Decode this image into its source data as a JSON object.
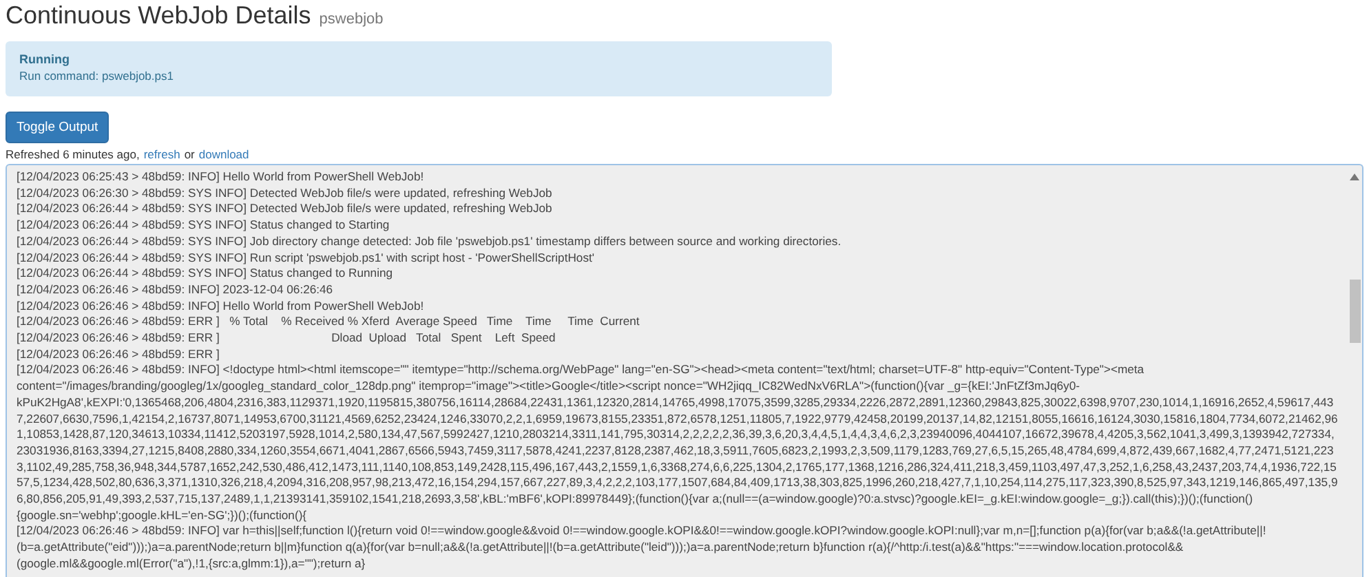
{
  "page_title": "Continuous WebJob Details",
  "job_name": "pswebjob",
  "status": {
    "state": "Running",
    "command": "Run command: pswebjob.ps1"
  },
  "toggle_button": "Toggle Output",
  "refresh_info": {
    "text": "Refreshed 6 minutes ago,",
    "refresh_link": "refresh",
    "separator": "or",
    "download_link": "download"
  },
  "log_lines": [
    "[12/04/2023 06:25:43 > 48bd59: INFO] Hello World from PowerShell WebJob!",
    "[12/04/2023 06:26:30 > 48bd59: SYS INFO] Detected WebJob file/s were updated, refreshing WebJob",
    "[12/04/2023 06:26:44 > 48bd59: SYS INFO] Detected WebJob file/s were updated, refreshing WebJob",
    "[12/04/2023 06:26:44 > 48bd59: SYS INFO] Status changed to Starting",
    "[12/04/2023 06:26:44 > 48bd59: SYS INFO] Job directory change detected: Job file 'pswebjob.ps1' timestamp differs between source and working directories.",
    "[12/04/2023 06:26:44 > 48bd59: SYS INFO] Run script 'pswebjob.ps1' with script host - 'PowerShellScriptHost'",
    "[12/04/2023 06:26:44 > 48bd59: SYS INFO] Status changed to Running",
    "[12/04/2023 06:26:46 > 48bd59: INFO] 2023-12-04 06:26:46",
    "[12/04/2023 06:26:46 > 48bd59: INFO] Hello World from PowerShell WebJob!",
    "[12/04/2023 06:26:46 > 48bd59: ERR ]   % Total    % Received % Xferd  Average Speed   Time    Time     Time  Current",
    "[12/04/2023 06:26:46 > 48bd59: ERR ]                                  Dload  Upload   Total   Spent    Left  Speed",
    "[12/04/2023 06:26:46 > 48bd59: ERR ]",
    "[12/04/2023 06:26:46 > 48bd59: INFO] <!doctype html><html itemscope=\"\" itemtype=\"http://schema.org/WebPage\" lang=\"en-SG\"><head><meta content=\"text/html; charset=UTF-8\" http-equiv=\"Content-Type\"><meta content=\"/images/branding/googleg/1x/googleg_standard_color_128dp.png\" itemprop=\"image\"><title>Google</title><script nonce=\"WH2jiqq_IC82WedNxV6RLA\">(function(){var _g={kEI:'JnFtZf3mJq6y0-kPuK2HgA8',kEXPI:'0,1365468,206,4804,2316,383,1129371,1920,1195815,380756,16114,28684,22431,1361,12320,2814,14765,4998,17075,3599,3285,29334,2226,2872,2891,12360,29843,825,30022,6398,9707,230,1014,1,16916,2652,4,59617,4437,22607,6630,7596,1,42154,2,16737,8071,14953,6700,31121,4569,6252,23424,1246,33070,2,2,1,6959,19673,8155,23351,872,6578,1251,11805,7,1922,9779,42458,20199,20137,14,82,12151,8055,16616,16124,3030,15816,1804,7734,6072,21462,961,10853,1428,87,120,34613,10334,11412,5203197,5928,1014,2,580,134,47,567,5992427,1210,2803214,3311,141,795,30314,2,2,2,2,2,36,39,3,6,20,3,4,4,5,1,4,4,3,4,6,2,3,23940096,4044107,16672,39678,4,4205,3,562,1041,3,499,3,1393942,727334,23031936,8163,3394,27,1215,8408,2880,334,1260,3554,6671,4041,2867,6566,5943,7459,3117,5878,4241,2237,8128,2387,462,18,3,5911,7605,6823,2,1993,2,3,509,1179,1283,769,27,6,5,15,265,48,4784,699,4,872,439,667,1682,4,77,2471,5121,2233,1102,49,285,758,36,948,344,5787,1652,242,530,486,412,1473,111,1140,108,853,149,2428,115,496,167,443,2,1559,1,6,3368,274,6,6,225,1304,2,1765,177,1368,1216,286,324,411,218,3,459,1103,497,47,3,252,1,6,258,43,2437,203,74,4,1936,722,1557,5,1234,428,502,80,636,3,371,1310,326,218,4,2094,316,208,957,98,213,472,16,154,294,157,667,227,89,3,4,2,2,2,103,177,1507,684,84,409,1713,38,303,825,1996,260,218,427,7,1,10,254,114,275,117,323,390,8,525,97,343,1219,146,865,497,135,96,80,856,205,91,49,393,2,537,715,137,2489,1,1,21393141,359102,1541,218,2693,3,58',kBL:'mBF6',kOPI:89978449};(function(){var a;(null==(a=window.google)?0:a.stvsc)?google.kEI=_g.kEI:window.google=_g;}).call(this);})();(function(){google.sn='webhp';google.kHL='en-SG';})();(function(){",
    "[12/04/2023 06:26:46 > 48bd59: INFO] var h=this||self;function l(){return void 0!==window.google&&void 0!==window.google.kOPI&&0!==window.google.kOPI?window.google.kOPI:null};var m,n=[];function p(a){for(var b;a&&(!a.getAttribute||!(b=a.getAttribute(\"eid\")));)a=a.parentNode;return b||m}function q(a){for(var b=null;a&&(!a.getAttribute||!(b=a.getAttribute(\"leid\")));)a=a.parentNode;return b}function r(a){/^http:/i.test(a)&&\"https:\"===window.location.protocol&&(google.ml&&google.ml(Error(\"a\"),!1,{src:a,glmm:1}),a=\"\");return a}"
  ]
}
